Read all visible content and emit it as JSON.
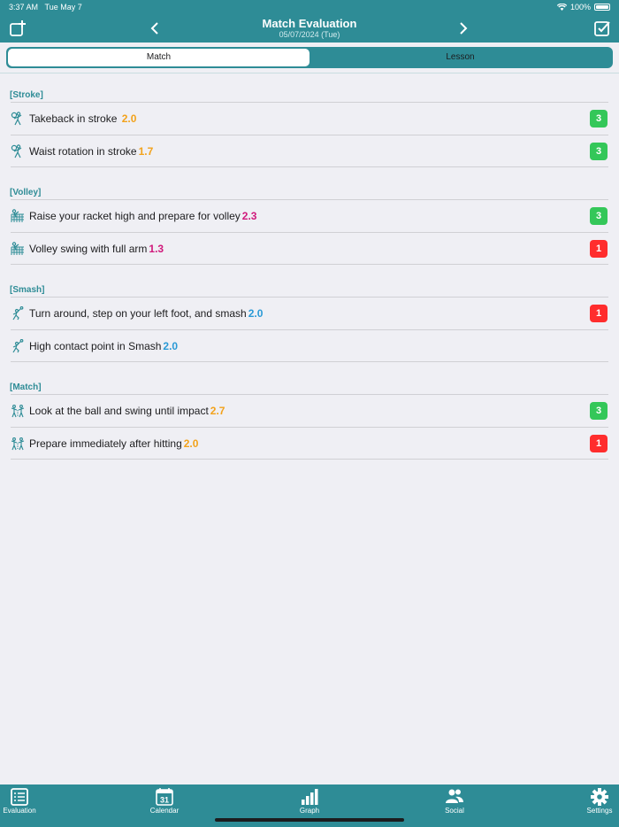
{
  "status": {
    "time": "3:37 AM",
    "date": "Tue May 7",
    "battery": "100%"
  },
  "nav": {
    "title": "Match Evaluation",
    "subtitle": "05/07/2024 (Tue)"
  },
  "segments": [
    {
      "label": "Match",
      "active": true
    },
    {
      "label": "Lesson",
      "active": false
    }
  ],
  "sections": [
    {
      "title": "[Stroke]",
      "icon": "stroke-player-icon",
      "items": [
        {
          "text": "Takeback in stroke ",
          "score": "2.0",
          "score_color": "#f2a21b",
          "badge": "3",
          "badge_color": "#34c759"
        },
        {
          "text": "Waist rotation in stroke",
          "score": "1.7",
          "score_color": "#f2a21b",
          "badge": "3",
          "badge_color": "#34c759"
        }
      ]
    },
    {
      "title": "[Volley]",
      "icon": "volley-net-icon",
      "items": [
        {
          "text": "Raise your racket high and prepare for volley",
          "score": "2.3",
          "score_color": "#d0197b",
          "badge": "3",
          "badge_color": "#34c759"
        },
        {
          "text": "Volley swing with full arm",
          "score": "1.3",
          "score_color": "#d0197b",
          "badge": "1",
          "badge_color": "#ff2d2d"
        }
      ]
    },
    {
      "title": "[Smash]",
      "icon": "smash-player-icon",
      "items": [
        {
          "text": "Turn around, step on your left foot, and smash",
          "score": "2.0",
          "score_color": "#2a9ad6",
          "badge": "1",
          "badge_color": "#ff2d2d"
        },
        {
          "text": "High contact point in Smash",
          "score": "2.0",
          "score_color": "#2a9ad6",
          "badge": "",
          "badge_color": ""
        }
      ]
    },
    {
      "title": "[Match]",
      "icon": "match-players-icon",
      "items": [
        {
          "text": "Look at the ball and swing until impact",
          "score": "2.7",
          "score_color": "#f2a21b",
          "badge": "3",
          "badge_color": "#34c759"
        },
        {
          "text": "Prepare immediately after hitting",
          "score": "2.0",
          "score_color": "#f2a21b",
          "badge": "1",
          "badge_color": "#ff2d2d"
        }
      ]
    }
  ],
  "tabs": [
    {
      "label": "Evaluation",
      "icon": "list-icon"
    },
    {
      "label": "Calendar",
      "icon": "calendar-icon",
      "icon_text": "31"
    },
    {
      "label": "Graph",
      "icon": "bar-chart-icon"
    },
    {
      "label": "Social",
      "icon": "people-icon"
    },
    {
      "label": "Settings",
      "icon": "gear-icon"
    }
  ],
  "colors": {
    "teal": "#2e8c96",
    "green_badge": "#34c759",
    "red_badge": "#ff2d2d"
  }
}
